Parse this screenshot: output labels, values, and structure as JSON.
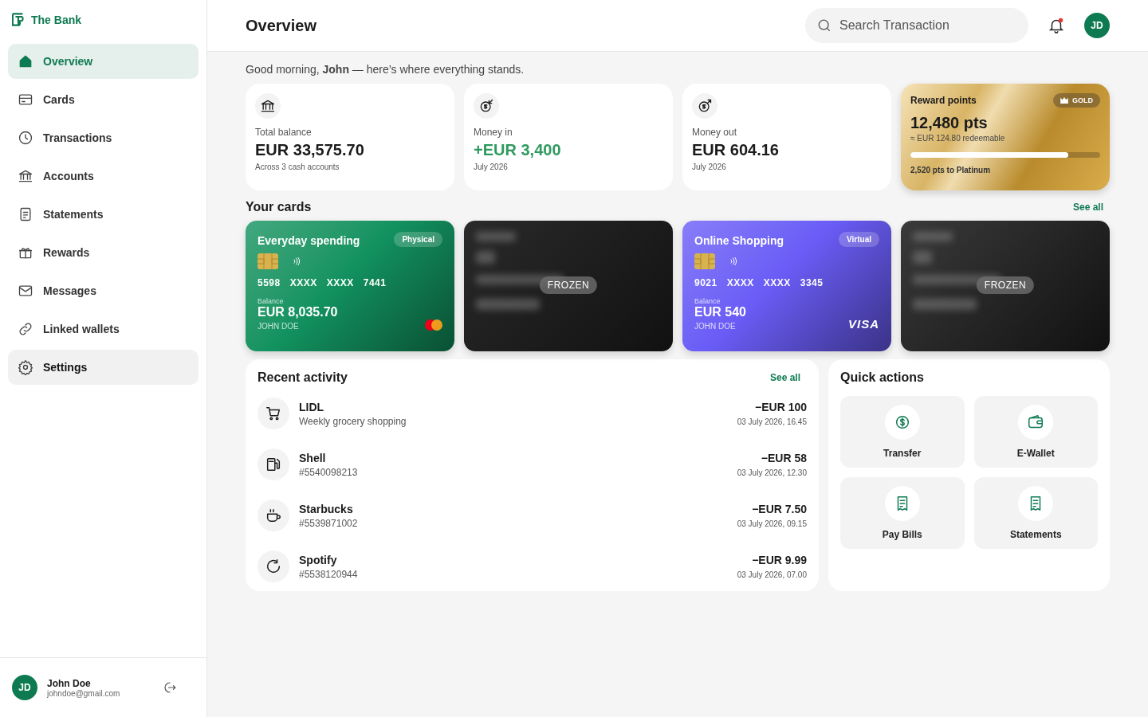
{
  "brand": {
    "name": "The Bank"
  },
  "sidebar": {
    "items": [
      {
        "label": "Overview",
        "selected": true,
        "hovered": false
      },
      {
        "label": "Cards",
        "selected": false,
        "hovered": false
      },
      {
        "label": "Transactions",
        "selected": false,
        "hovered": false
      },
      {
        "label": "Accounts",
        "selected": false,
        "hovered": false
      },
      {
        "label": "Statements",
        "selected": false,
        "hovered": false
      },
      {
        "label": "Rewards",
        "selected": false,
        "hovered": false
      },
      {
        "label": "Messages",
        "selected": false,
        "hovered": false
      },
      {
        "label": "Linked wallets",
        "selected": false,
        "hovered": false
      },
      {
        "label": "Settings",
        "selected": false,
        "hovered": true
      }
    ],
    "user": {
      "initials": "JD",
      "name": "John Doe",
      "email": "johndoe@gmail.com"
    }
  },
  "header": {
    "title": "Overview",
    "search": {
      "placeholder": "Search Transaction"
    },
    "notifications": {
      "unread": true
    },
    "avatar": "JD"
  },
  "greeting": "Good morning, **John** — here’s where everything stands.",
  "stats": [
    {
      "label": "Total balance",
      "value": "EUR 33,575.70",
      "note": "Across 3 cash accounts",
      "positive": false
    },
    {
      "label": "Money in",
      "value": "+EUR 3,400",
      "note": "July 2026",
      "positive": true
    },
    {
      "label": "Money out",
      "value": "EUR 604.16",
      "note": "July 2026",
      "positive": false
    }
  ],
  "rewards": {
    "title": "Reward points",
    "tier": "GOLD",
    "points": "12,480 pts",
    "redeemable": "≈ EUR 124.80 redeemable",
    "level": 0.83,
    "next": "2,520 pts to Platinum"
  },
  "cards_section": {
    "title": "Your cards",
    "see_all": "See all",
    "cards": [
      {
        "frozen": false,
        "color": "#12925f",
        "name": "Everyday spending",
        "type": "Physical",
        "number": [
          "5598",
          "XXXX",
          "XXXX",
          "7441"
        ],
        "balance_label": "Balance",
        "balance": "EUR 8,035.70",
        "holder": "JOHN DOE",
        "logo": {
          "kind": "mastercard"
        }
      },
      {
        "frozen": true,
        "color": "#2a2a2a",
        "status": "FROZEN"
      },
      {
        "frozen": false,
        "color": "#6a5cf6",
        "name": "Online Shopping",
        "type": "Virtual",
        "number": [
          "9021",
          "XXXX",
          "XXXX",
          "3345"
        ],
        "balance_label": "Balance",
        "balance": "EUR 540",
        "holder": "JOHN DOE",
        "logo": {
          "kind": "visa",
          "text": "VISA"
        }
      },
      {
        "frozen": true,
        "color": "#3a3a3a",
        "status": "FROZEN"
      }
    ]
  },
  "recent_activity": {
    "title": "Recent activity",
    "see_all": "See all",
    "items": [
      {
        "merchant": "LIDL",
        "detail": "Weekly grocery shopping",
        "amount": "−EUR 100",
        "date": "03 July 2026, 16.45"
      },
      {
        "merchant": "Shell",
        "detail": "#5540098213",
        "amount": "−EUR 58",
        "date": "03 July 2026, 12.30"
      },
      {
        "merchant": "Starbucks",
        "detail": "#5539871002",
        "amount": "−EUR 7.50",
        "date": "03 July 2026, 09.15"
      },
      {
        "merchant": "Spotify",
        "detail": "#5538120944",
        "amount": "−EUR 9.99",
        "date": "03 July 2026, 07.00"
      }
    ]
  },
  "quick_actions": {
    "title": "Quick actions",
    "items": [
      {
        "label": "Transfer"
      },
      {
        "label": "E-Wallet"
      },
      {
        "label": "Pay Bills"
      },
      {
        "label": "Statements"
      }
    ]
  }
}
